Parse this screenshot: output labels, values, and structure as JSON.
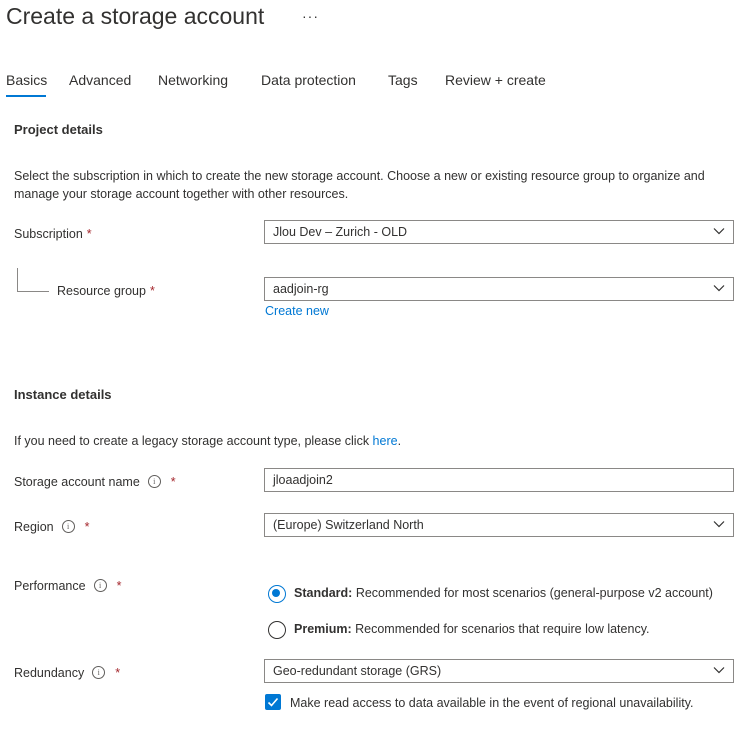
{
  "page": {
    "title": "Create a storage account",
    "more": "···"
  },
  "tabs": [
    {
      "label": "Basics",
      "active": true
    },
    {
      "label": "Advanced"
    },
    {
      "label": "Networking"
    },
    {
      "label": "Data protection"
    },
    {
      "label": "Tags"
    },
    {
      "label": "Review + create"
    }
  ],
  "project": {
    "heading": "Project details",
    "description": "Select the subscription in which to create the new storage account. Choose a new or existing resource group to organize and manage your storage account together with other resources.",
    "subscription_label": "Subscription",
    "subscription_value": "Jlou Dev – Zurich - OLD",
    "resource_group_label": "Resource group",
    "resource_group_value": "aadjoin-rg",
    "create_new": "Create new"
  },
  "instance": {
    "heading": "Instance details",
    "legacy_text": "If you need to create a legacy storage account type, please click ",
    "legacy_link": "here",
    "legacy_end": ".",
    "name_label": "Storage account name",
    "name_value": "jloaadjoin2",
    "region_label": "Region",
    "region_value": "(Europe) Switzerland North",
    "performance_label": "Performance",
    "standard_bold": "Standard:",
    "standard_text": " Recommended for most scenarios (general-purpose v2 account)",
    "premium_bold": "Premium:",
    "premium_text": " Recommended for scenarios that require low latency.",
    "redundancy_label": "Redundancy",
    "redundancy_value": "Geo-redundant storage (GRS)",
    "read_access_text": "Make read access to data available in the event of regional unavailability."
  },
  "common": {
    "required_marker": "*",
    "info_glyph": "i"
  },
  "colors": {
    "accent": "#0078d4",
    "required": "#a4262c",
    "text": "#323130",
    "border": "#8a8886"
  },
  "state": {
    "performance": "Standard",
    "read_access_checked": true
  }
}
